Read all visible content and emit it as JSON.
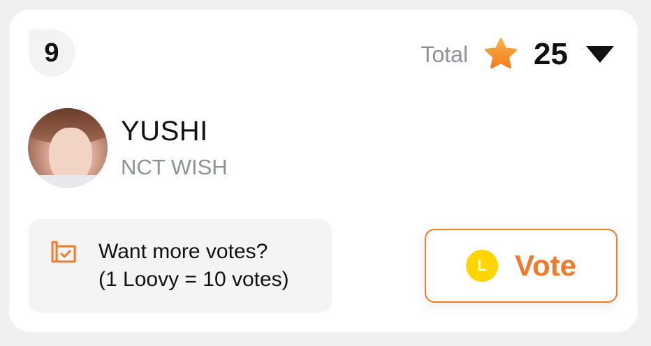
{
  "rank": "9",
  "total": {
    "label": "Total",
    "count": "25",
    "icon": "star-icon",
    "dropdown_icon": "caret-down-icon"
  },
  "artist": {
    "name": "YUSHI",
    "group": "NCT WISH"
  },
  "promo": {
    "icon": "ticket-icon",
    "line1": "Want more votes?",
    "line2": "(1 Loovy = 10 votes)"
  },
  "vote_button": {
    "coin_letter": "L",
    "label": "Vote"
  },
  "colors": {
    "accent": "#f07a2a",
    "star": "#f79a2e",
    "coin": "#ffd500",
    "muted_text": "#8d9299"
  }
}
